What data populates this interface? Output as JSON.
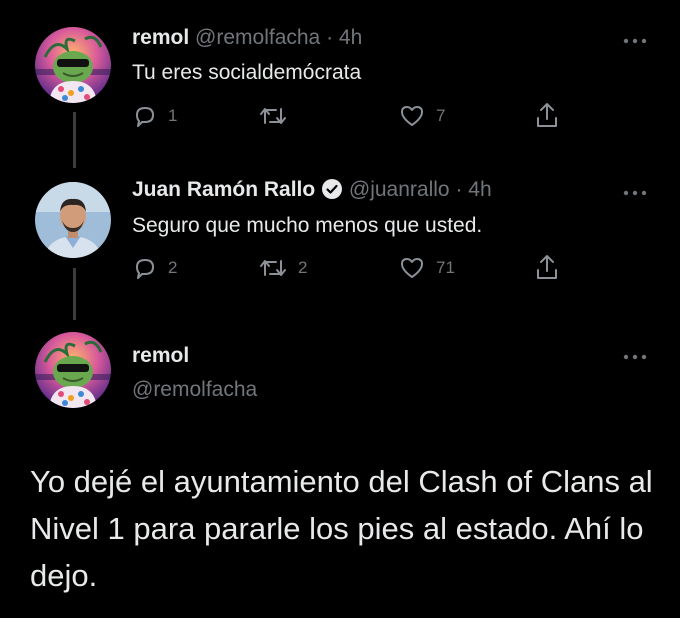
{
  "tweets": [
    {
      "name": "remol",
      "handle": "@remolfacha",
      "time": "4h",
      "text": "Tu eres socialdemócrata",
      "replies": "1",
      "retweets": "",
      "likes": "7",
      "avatar_icon": "pepe-hawaiian-avatar"
    },
    {
      "name": "Juan Ramón Rallo",
      "handle": "@juanrallo",
      "time": "4h",
      "text": "Seguro que mucho menos que usted.",
      "replies": "2",
      "retweets": "2",
      "likes": "71",
      "verified": true,
      "avatar_icon": "person-photo-avatar"
    }
  ],
  "main_tweet": {
    "name": "remol",
    "handle": "@remolfacha",
    "text": "Yo dejé el ayuntamiento del Clash of Clans al Nivel 1 para pararle los pies al estado. Ahí lo dejo."
  },
  "separator": "·",
  "colors": {
    "background": "#000000",
    "text": "#e7e9ea",
    "muted": "#71767b",
    "thread_line": "#3a3d40"
  }
}
